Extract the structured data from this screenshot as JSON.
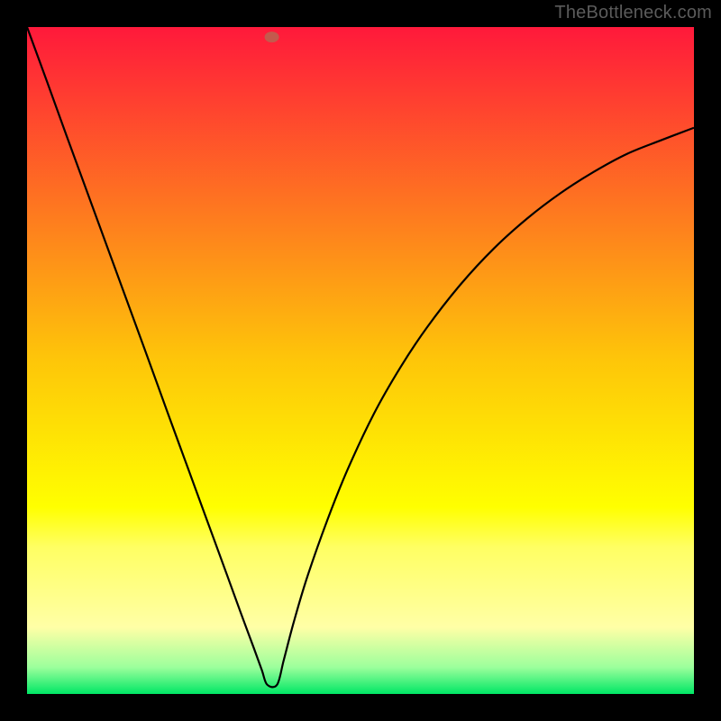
{
  "watermark": "TheBottleneck.com",
  "chart_data": {
    "type": "line",
    "title": "",
    "xlabel": "",
    "ylabel": "",
    "xlim": [
      0,
      1
    ],
    "ylim": [
      0,
      1
    ],
    "background_gradient": {
      "stops": [
        {
          "offset": 0.0,
          "color": "#ff193b"
        },
        {
          "offset": 0.5,
          "color": "#fec609"
        },
        {
          "offset": 0.72,
          "color": "#ffff00"
        },
        {
          "offset": 0.78,
          "color": "#ffff63"
        },
        {
          "offset": 0.9,
          "color": "#ffffa6"
        },
        {
          "offset": 0.96,
          "color": "#9cff9c"
        },
        {
          "offset": 1.0,
          "color": "#00e765"
        }
      ]
    },
    "marker": {
      "x": 0.367,
      "y": 0.985,
      "color": "#c35a4d"
    },
    "series": [
      {
        "name": "curve",
        "x": [
          0.0,
          0.03,
          0.06,
          0.09,
          0.12,
          0.15,
          0.18,
          0.21,
          0.24,
          0.27,
          0.3,
          0.32,
          0.34,
          0.352,
          0.36,
          0.375,
          0.385,
          0.4,
          0.42,
          0.45,
          0.48,
          0.52,
          0.56,
          0.6,
          0.65,
          0.7,
          0.75,
          0.8,
          0.85,
          0.9,
          0.95,
          1.0
        ],
        "y": [
          1.0,
          0.918,
          0.835,
          0.753,
          0.671,
          0.589,
          0.507,
          0.424,
          0.342,
          0.26,
          0.178,
          0.123,
          0.069,
          0.036,
          0.014,
          0.014,
          0.051,
          0.108,
          0.175,
          0.26,
          0.335,
          0.42,
          0.49,
          0.55,
          0.614,
          0.668,
          0.713,
          0.751,
          0.783,
          0.81,
          0.83,
          0.849
        ]
      }
    ]
  }
}
